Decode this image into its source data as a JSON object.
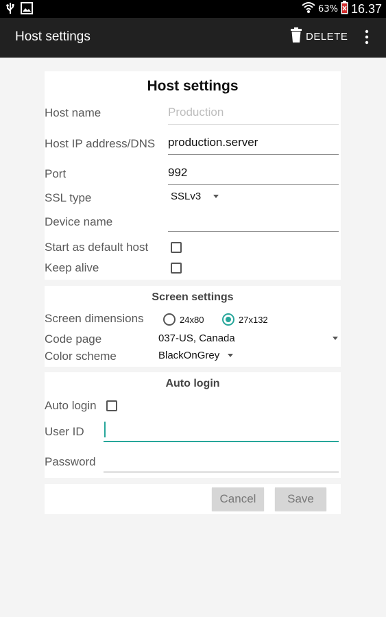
{
  "status_bar": {
    "battery_percent": "63%",
    "time": "16.37",
    "icons": [
      "usb-icon",
      "image-icon",
      "wifi-icon",
      "battery-icon"
    ]
  },
  "app_bar": {
    "title": "Host settings",
    "delete_label": "DELETE",
    "icons": [
      "trash-icon",
      "overflow-menu-icon"
    ]
  },
  "host_settings": {
    "title": "Host settings",
    "host_name": {
      "label": "Host name",
      "value": "",
      "placeholder": "Production"
    },
    "host_ip": {
      "label": "Host IP address/DNS",
      "value": "production.server"
    },
    "port": {
      "label": "Port",
      "value": "992"
    },
    "ssl_type": {
      "label": "SSL type",
      "selected": "SSLv3"
    },
    "device_name": {
      "label": "Device name",
      "value": ""
    },
    "start_default": {
      "label": "Start as default host",
      "checked": false
    },
    "keep_alive": {
      "label": "Keep alive",
      "checked": false
    }
  },
  "screen_settings": {
    "title": "Screen settings",
    "dimensions": {
      "label": "Screen dimensions",
      "options": [
        "24x80",
        "27x132"
      ],
      "selected": "27x132"
    },
    "code_page": {
      "label": "Code page",
      "selected": "037-US, Canada"
    },
    "color_scheme": {
      "label": "Color scheme",
      "selected": "BlackOnGrey"
    }
  },
  "auto_login": {
    "title": "Auto login",
    "auto_login": {
      "label": "Auto login",
      "checked": false
    },
    "user_id": {
      "label": "User ID",
      "value": ""
    },
    "password": {
      "label": "Password",
      "value": ""
    }
  },
  "actions": {
    "cancel_label": "Cancel",
    "save_label": "Save"
  },
  "colors": {
    "accent": "#26a69a",
    "app_bar": "#212121",
    "background": "#f4f4f4",
    "button": "#d6d6d6"
  }
}
